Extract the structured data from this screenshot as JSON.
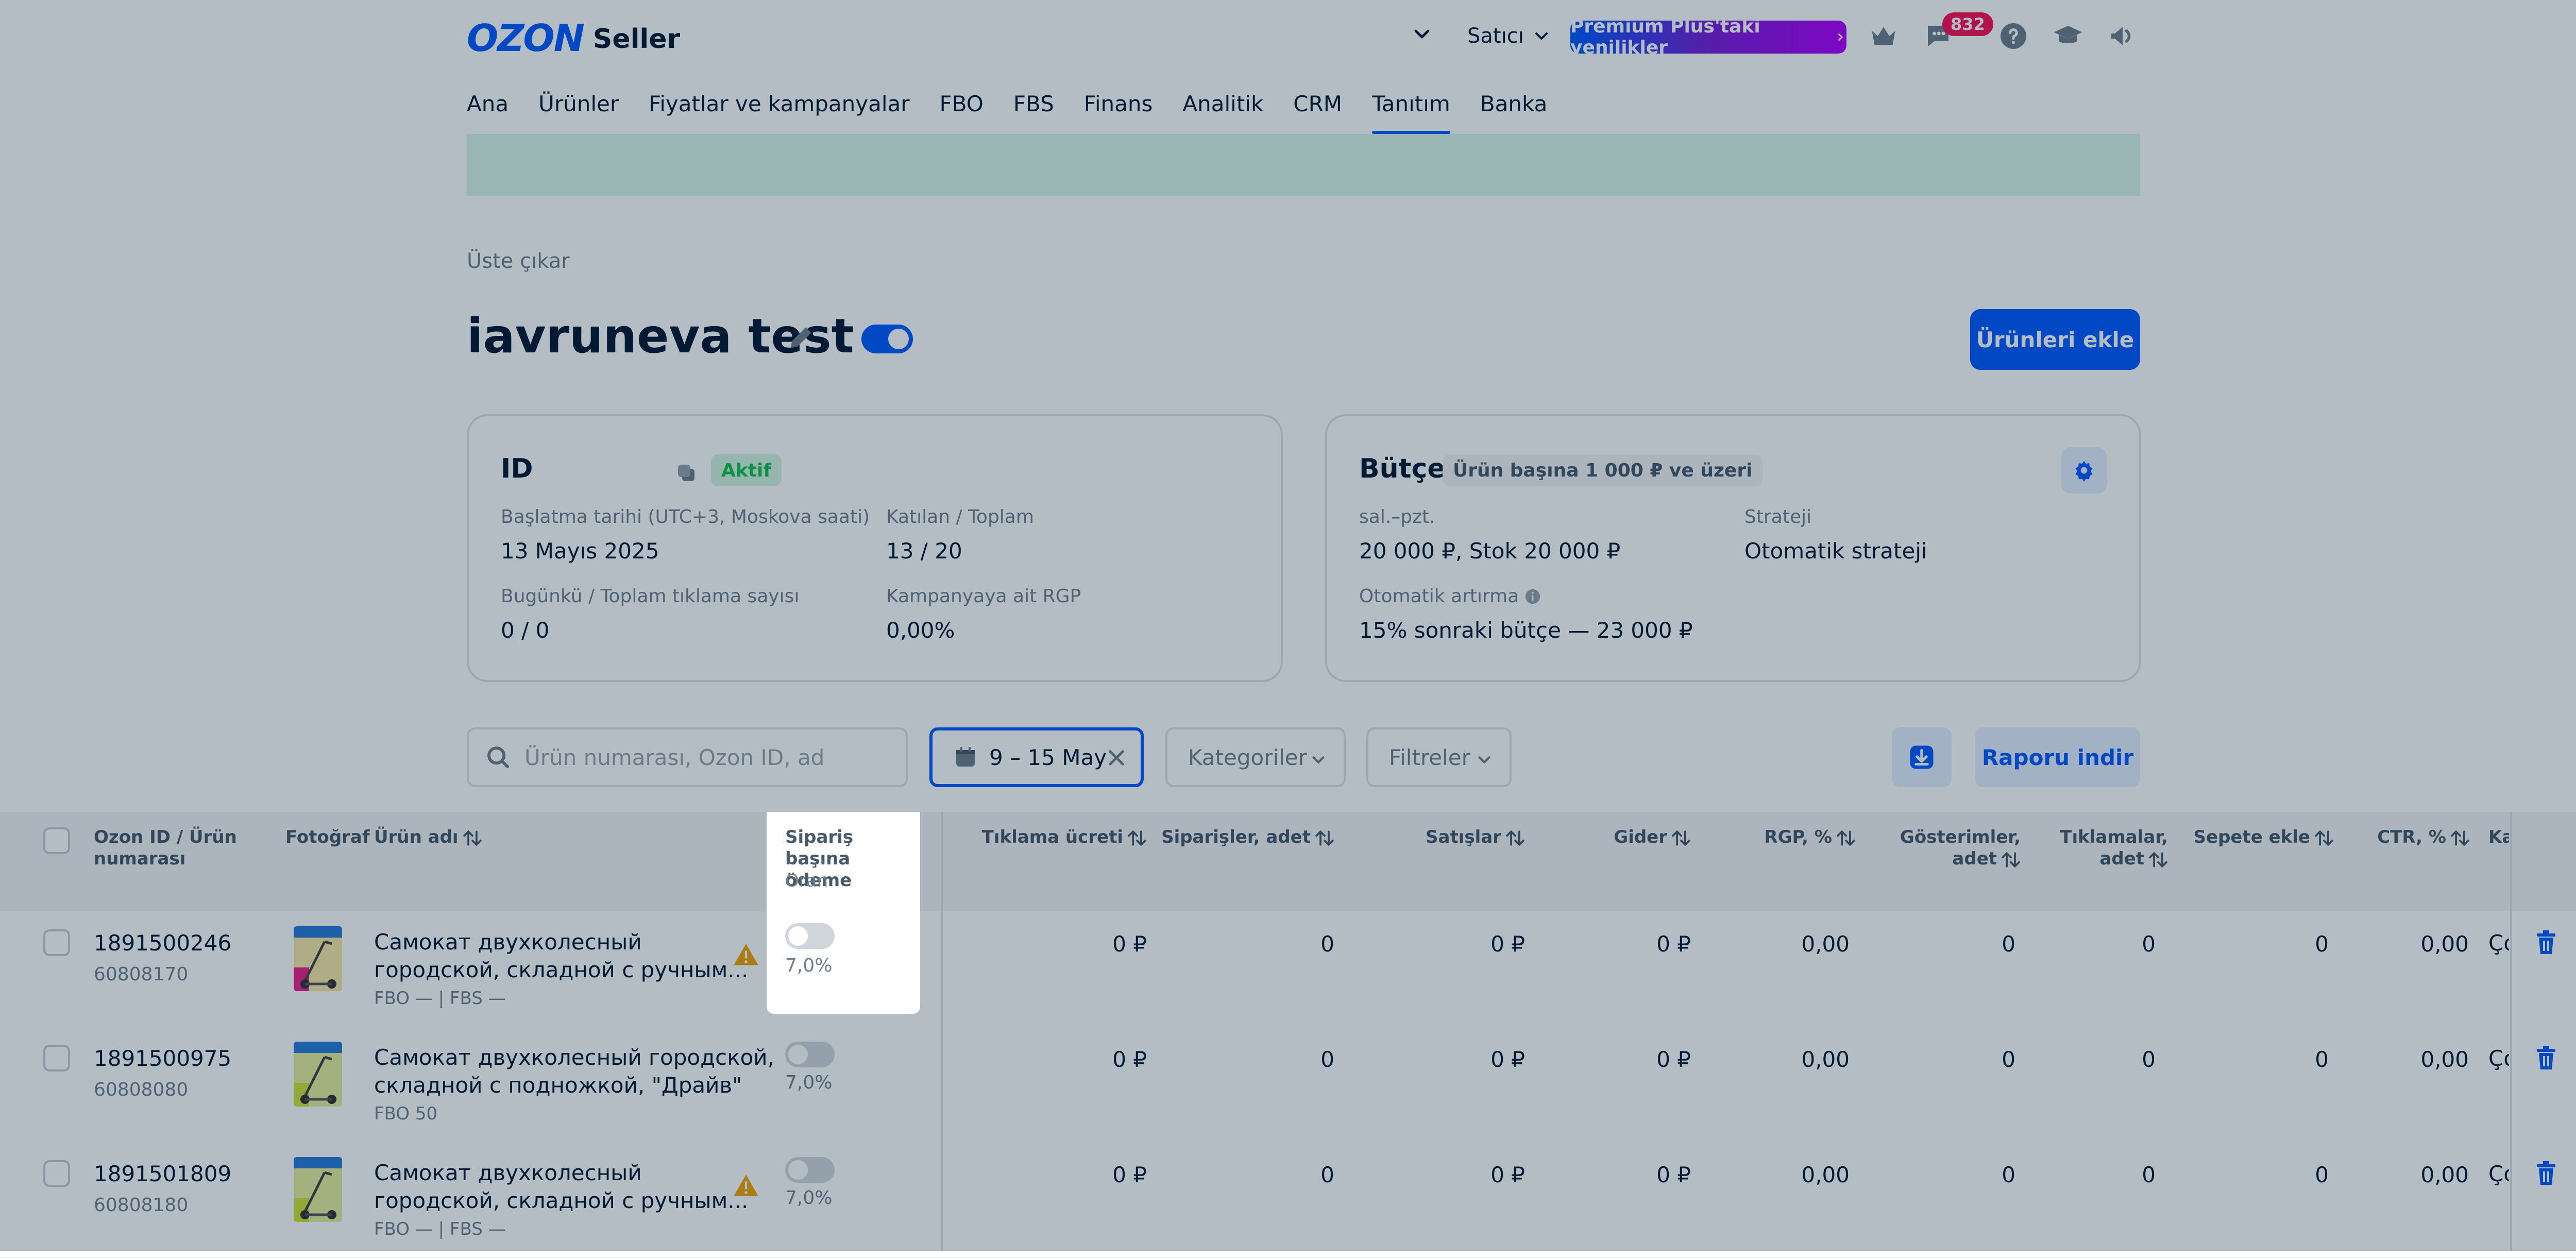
{
  "header": {
    "logo_brand": "OZON",
    "logo_product": "Seller",
    "seller_label": "Satıcı",
    "premium_label": "Premium Plus'taki yenilikler",
    "notifications_count": "832"
  },
  "nav": [
    "Ana",
    "Ürünler",
    "Fiyatlar ve kampanyalar",
    "FBO",
    "FBS",
    "Finans",
    "Analitik",
    "CRM",
    "Tanıtım",
    "Banka"
  ],
  "nav_active": "Tanıtım",
  "breadcrumb": "Üste çıkar",
  "campaign": {
    "title": "iavruneva test",
    "add_button": "Ürünleri ekle"
  },
  "card_id": {
    "title": "ID",
    "status": "Aktif",
    "fields": [
      {
        "label": "Başlatma tarihi (UTC+3, Moskova saati)",
        "value": "13 Mayıs 2025"
      },
      {
        "label": "Katılan / Toplam",
        "value": "13 / 20"
      },
      {
        "label": "Bugünkü / Toplam tıklama sayısı",
        "value": "0 / 0"
      },
      {
        "label": "Kampanyaya ait RGP",
        "value": "0,00%"
      }
    ]
  },
  "card_budget": {
    "title": "Bütçe",
    "chip": "Ürün başına 1 000 ₽ ve üzeri",
    "fields": [
      {
        "label": "sal.–pzt.",
        "value": "20 000 ₽, Stok 20 000 ₽"
      },
      {
        "label": "Strateji",
        "value": "Otomatik strateji"
      },
      {
        "label": "Otomatik artırma",
        "value": "15% sonraki bütçe — 23 000 ₽"
      }
    ]
  },
  "toolbar": {
    "search_placeholder": "Ürün numarası, Ozon ID, ad",
    "date_range": "9 – 15 May",
    "categories": "Kategoriler",
    "filters": "Filtreler",
    "report_button": "Raporu indir"
  },
  "table": {
    "headers": {
      "id": "Ozon ID / Ürün numarası",
      "photo": "Fotoğraf",
      "name": "Ürün adı",
      "order_pay": "Sipariş başına ödeme",
      "order_pay_sub": "Oran",
      "click_price": "Tıklama ücreti",
      "orders": "Siparişler, adet",
      "sales": "Satışlar",
      "expense": "Gider",
      "rgp": "RGP, %",
      "impressions": "Gösterimler, adet",
      "clicks": "Tıklamalar, adet",
      "cart": "Sepete ekle",
      "ctr": "CTR, %",
      "more": "Ka"
    },
    "rows": [
      {
        "id": "1891500246",
        "sku": "60808170",
        "name_line1": "Самокат двухколесный",
        "name_line2": "городской, складной с ручным...",
        "stock": "FBO — | FBS —",
        "warn": true,
        "rate": "7,0%",
        "click_price": "0 ₽",
        "orders": "0",
        "sales": "0 ₽",
        "expense": "0 ₽",
        "rgp": "0,00",
        "impressions": "0",
        "clicks": "0",
        "cart": "0",
        "ctr": "0,00",
        "more": "Ço"
      },
      {
        "id": "1891500975",
        "sku": "60808080",
        "name_line1": "Самокат двухколесный городской,",
        "name_line2": "складной с подножкой, \"Драйв\"",
        "stock": "FBO 50",
        "warn": false,
        "rate": "7,0%",
        "click_price": "0 ₽",
        "orders": "0",
        "sales": "0 ₽",
        "expense": "0 ₽",
        "rgp": "0,00",
        "impressions": "0",
        "clicks": "0",
        "cart": "0",
        "ctr": "0,00",
        "more": "Ço"
      },
      {
        "id": "1891501809",
        "sku": "60808180",
        "name_line1": "Самокат двухколесный",
        "name_line2": "городской, складной с ручным...",
        "stock": "FBO — | FBS —",
        "warn": true,
        "rate": "7,0%",
        "click_price": "0 ₽",
        "orders": "0",
        "sales": "0 ₽",
        "expense": "0 ₽",
        "rgp": "0,00",
        "impressions": "0",
        "clicks": "0",
        "cart": "0",
        "ctr": "0,00",
        "more": "Ço"
      }
    ]
  },
  "colors": {
    "accent": "#005bff",
    "success": "#10c44c",
    "badge": "#f91155",
    "warning": "#f1a209"
  }
}
